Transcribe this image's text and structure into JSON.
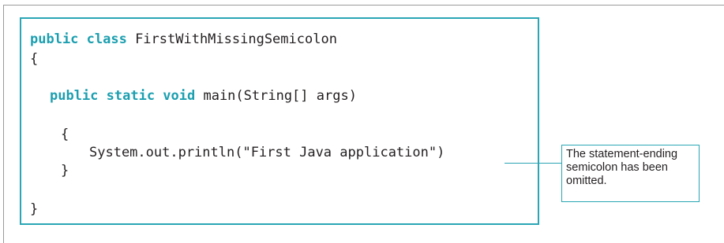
{
  "code": {
    "line1": {
      "kw": "public class",
      "rest": " FirstWithMissingSemicolon"
    },
    "line2": "{",
    "line3": {
      "kw": "public static void",
      "rest": " main(String[] args)"
    },
    "line4": "{",
    "line5": "System.out.println(\"First Java application\")",
    "line6": "}",
    "line7": "}"
  },
  "callout": {
    "lines": [
      "The statement-ending",
      "semicolon has been",
      "omitted."
    ]
  },
  "colors": {
    "accent": "#2aa6b5",
    "keyword": "#1b9fb0",
    "text": "#231f20",
    "frame": "#9a9a9a"
  }
}
